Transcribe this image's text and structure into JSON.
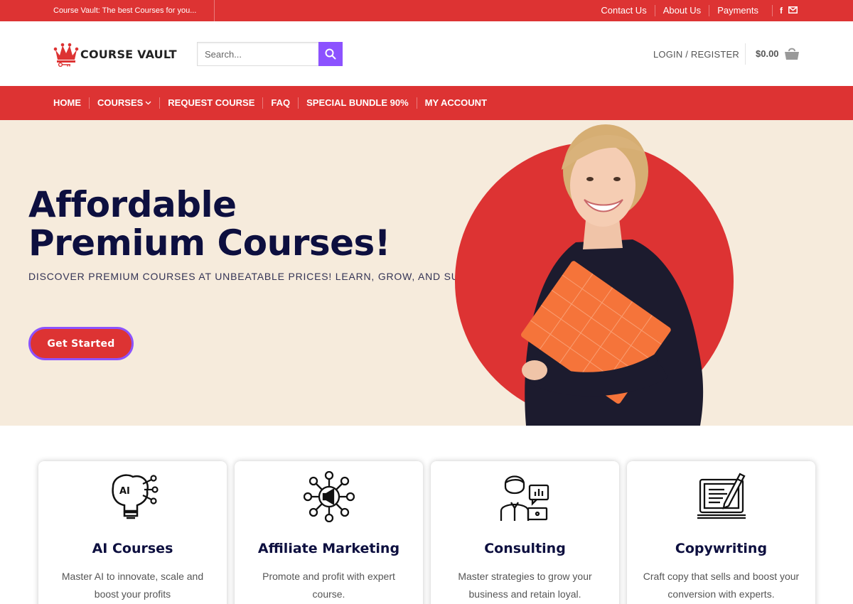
{
  "topbar": {
    "tagline": "Course Vault: The best Courses for you...",
    "links": [
      "Contact Us",
      "About Us",
      "Payments"
    ]
  },
  "header": {
    "logo_text": "COURSE VAULT",
    "search_placeholder": "Search...",
    "login_label": "LOGIN / REGISTER",
    "cart_total": "$0.00"
  },
  "nav": {
    "items": [
      "HOME",
      "COURSES",
      "REQUEST COURSE",
      "FAQ",
      "SPECIAL BUNDLE 90%",
      "MY ACCOUNT"
    ]
  },
  "hero": {
    "title_line1": "Affordable",
    "title_line2": "Premium Courses!",
    "subtitle": "DISCOVER PREMIUM COURSES AT UNBEATABLE PRICES! LEARN, GROW, AND SUCCEED",
    "cta_label": "Get Started"
  },
  "cards": [
    {
      "title": "AI Courses",
      "description": "Master AI to innovate, scale and boost your profits",
      "icon_text": "AI"
    },
    {
      "title": "Affiliate Marketing",
      "description": "Promote and profit with expert course."
    },
    {
      "title": "Consulting",
      "description": "Master strategies to grow your business and retain loyal."
    },
    {
      "title": "Copywriting",
      "description": "Craft copy that sells and boost your conversion with experts."
    }
  ],
  "colors": {
    "brand_red": "#dd3333",
    "accent_purple": "#8c52ff",
    "hero_bg": "#f6ebdc",
    "heading_navy": "#0d0f3f"
  }
}
